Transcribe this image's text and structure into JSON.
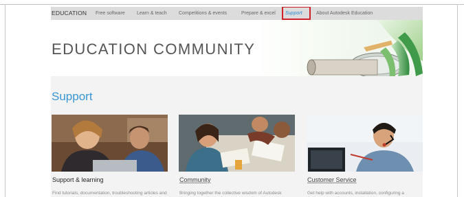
{
  "nav": {
    "brand": "EDUCATION",
    "items": [
      {
        "label": "Free software"
      },
      {
        "label": "Learn & teach"
      },
      {
        "label": "Competitions & events"
      },
      {
        "label": "Prepare & excel"
      },
      {
        "label": "Support"
      },
      {
        "label": "About Autodesk Education"
      }
    ],
    "active_index": 4
  },
  "hero": {
    "title": "EDUCATION COMMUNITY"
  },
  "section": {
    "title": "Support"
  },
  "cards": [
    {
      "title": "Support & learning",
      "description": "Find tutorials, documentation, troubleshooting articles and more."
    },
    {
      "title": "Community",
      "description": "Bringing together the collective wisdom of Autodesk customers and experts."
    },
    {
      "title": "Customer Service",
      "description": "Get help with accounts, installation, configuring a deployment and more."
    }
  ],
  "colors": {
    "accent_blue": "#3a96d4",
    "highlight_red": "#d0212a",
    "nav_bg": "#dcdcdc"
  }
}
